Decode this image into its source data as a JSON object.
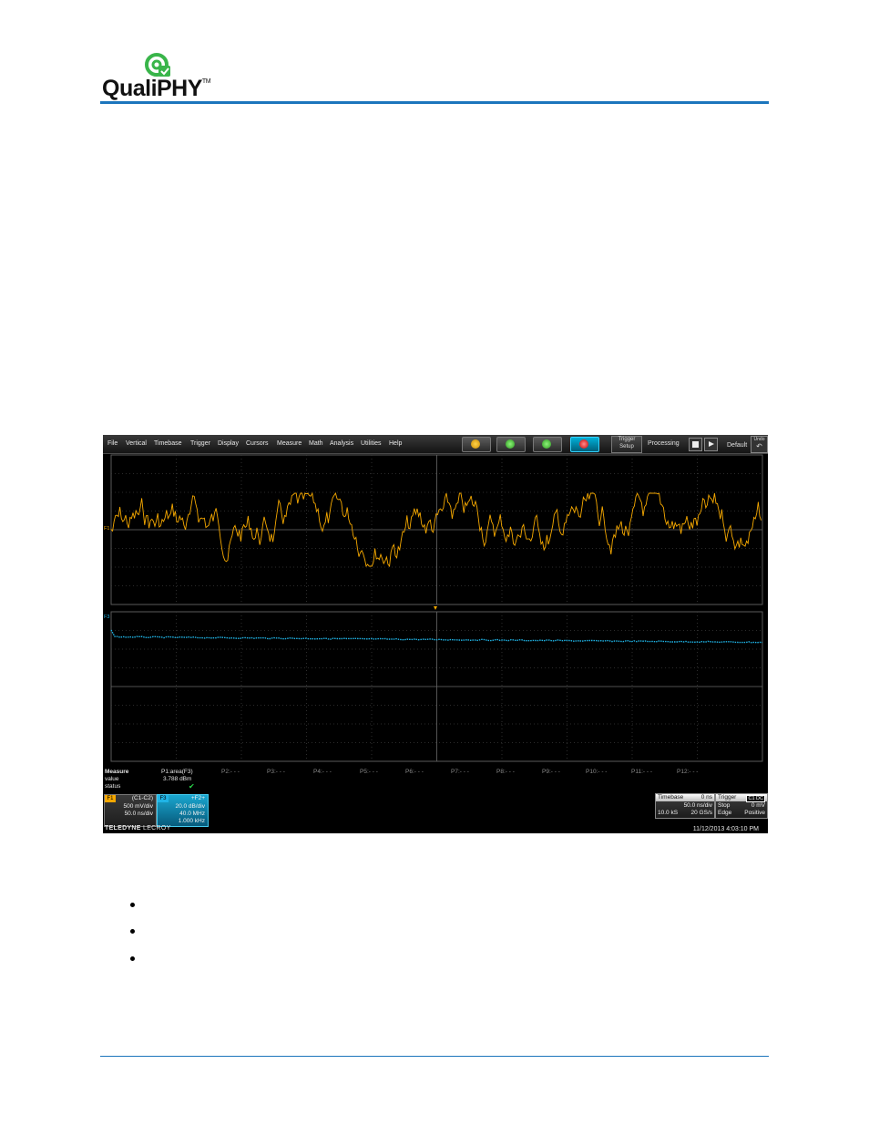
{
  "logo": {
    "text": "QualiPHY",
    "trademark": "TM",
    "color": "#1c75bc",
    "accent": "#39b54a"
  },
  "scope": {
    "menu": [
      "File",
      "Vertical",
      "Timebase",
      "Trigger",
      "Display",
      "Cursors",
      "Measure",
      "Math",
      "Analysis",
      "Utilities",
      "Help"
    ],
    "toolbar": {
      "trigger_setup_line1": "Trigger",
      "trigger_setup_line2": "Setup",
      "status": "Processing",
      "default_label": "Default",
      "undo_line1": "Undo",
      "undo_arrow": "↶"
    },
    "traces": {
      "f1_label": "F1",
      "f3_label": "F3",
      "f1_color": "#f5a800",
      "f3_color": "#1fb4e6"
    },
    "measure": {
      "row_labels": [
        "Measure",
        "value",
        "status"
      ],
      "p1_name": "P1:area(F3)",
      "p1_value": "3.788 dBm",
      "p1_status": "✔",
      "params": [
        "P2:- - -",
        "P3:- - -",
        "P4:- - -",
        "P5:- - -",
        "P6:- - -",
        "P7:- - -",
        "P8:- - -",
        "P9:- - -",
        "P10:- - -",
        "P11:- - -",
        "P12:- - -"
      ]
    },
    "f1_box": {
      "tag": "F1",
      "title": "(C1-C2)",
      "line1": "500 mV/div",
      "line2": "50.0 ns/div"
    },
    "f3_box": {
      "tag": "F3",
      "title": "+F2+",
      "line1": "20.0 dB/div",
      "line2": "40.0 MHz",
      "line3": "1.000 kHz"
    },
    "timebase": {
      "label": "Timebase",
      "delay": "0 ns",
      "per_div": "50.0 ns/div",
      "samples": "10.0 kS",
      "rate": "20 GS/s"
    },
    "trigger": {
      "label": "Trigger",
      "badge": "C1 DC",
      "mode": "Stop",
      "level": "0 mV",
      "type": "Edge",
      "slope": "Positive"
    },
    "brand_bold": "TELEDYNE",
    "brand_light": "LECROY",
    "datetime": "11/12/2013 4:03:10 PM"
  }
}
